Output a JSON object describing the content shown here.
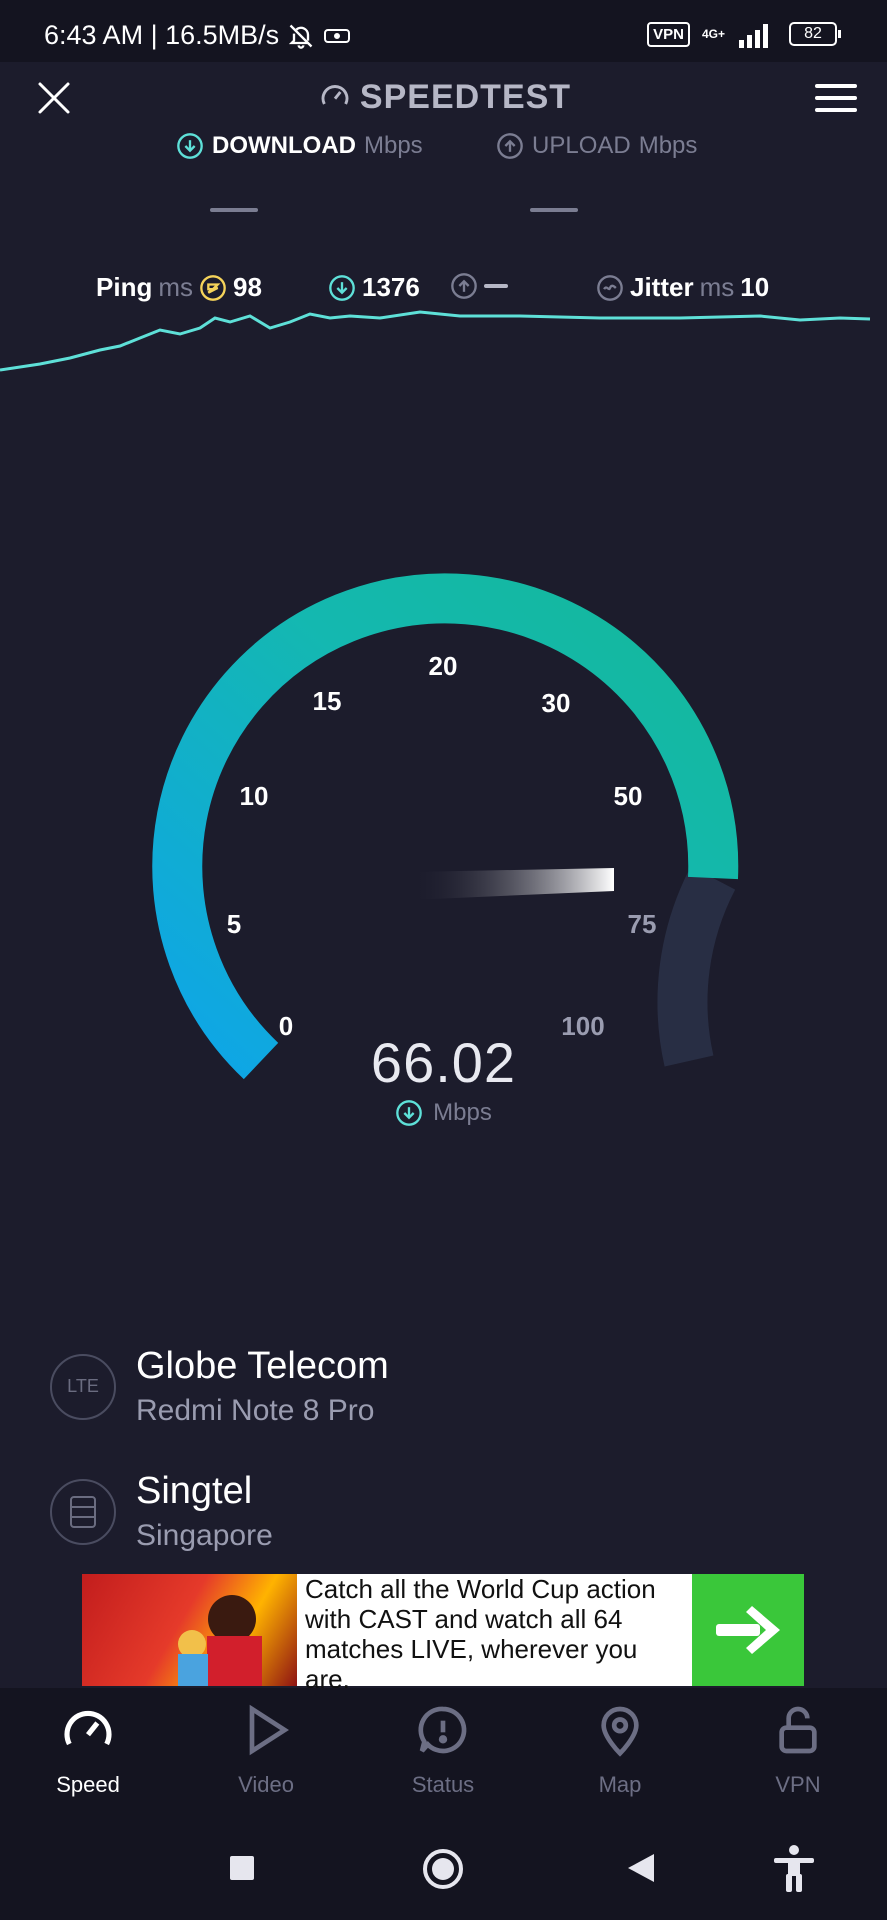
{
  "status_bar": {
    "time_speed": "6:43 AM | 16.5MB/s",
    "vpn": "VPN",
    "network": "4G+",
    "battery": "82"
  },
  "header": {
    "title": "SPEEDTEST"
  },
  "download": {
    "label": "DOWNLOAD",
    "unit": "Mbps"
  },
  "upload": {
    "label": "UPLOAD",
    "unit": "Mbps"
  },
  "stats": {
    "ping_label": "Ping",
    "ping_unit": "ms",
    "ping_value": "98",
    "download_value": "1376",
    "jitter_label": "Jitter",
    "jitter_unit": "ms",
    "jitter_value": "10"
  },
  "gauge": {
    "ticks": [
      "0",
      "5",
      "10",
      "15",
      "20",
      "30",
      "50",
      "75",
      "100"
    ],
    "current_value": "66.02",
    "unit": "Mbps"
  },
  "provider": {
    "network_badge": "LTE",
    "name": "Globe Telecom",
    "device": "Redmi Note 8 Pro"
  },
  "server": {
    "name": "Singtel",
    "location": "Singapore"
  },
  "ad": {
    "text": "Catch all the World Cup action with CAST and watch all 64 matches LIVE, wherever you are."
  },
  "nav": [
    {
      "label": "Speed"
    },
    {
      "label": "Video"
    },
    {
      "label": "Status"
    },
    {
      "label": "Map"
    },
    {
      "label": "VPN"
    }
  ],
  "colors": {
    "background": "#1c1c2c",
    "accent_teal": "#14b8a6",
    "accent_blue": "#0ea5e9",
    "ping_yellow": "#f5d35a",
    "cta_green": "#3ac73a"
  }
}
